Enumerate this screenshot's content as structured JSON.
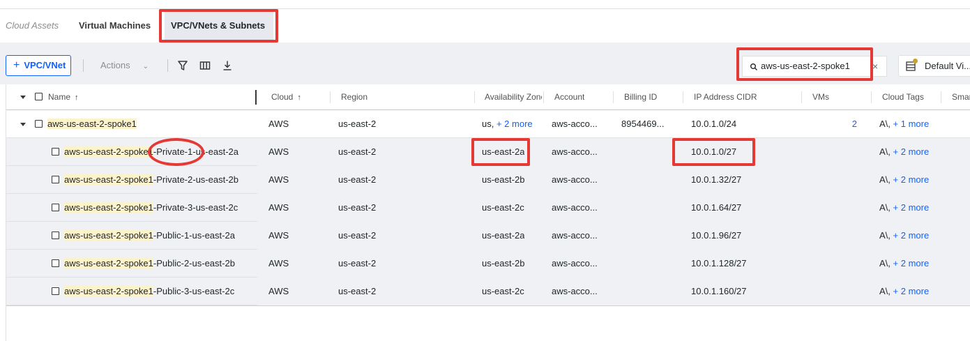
{
  "tabs": [
    {
      "label": "Cloud Assets"
    },
    {
      "label": "Virtual Machines"
    },
    {
      "label": "VPC/VNets & Subnets"
    }
  ],
  "toolbar": {
    "add_button_label": "VPC/VNet",
    "actions_label": "Actions",
    "search_value": "aws-us-east-2-spoke1",
    "view_label": "Default Vi...",
    "icons": [
      "plus-icon",
      "chevron-down-icon",
      "filter-icon",
      "columns-icon",
      "download-icon",
      "search-icon",
      "close-icon",
      "view-list-icon"
    ]
  },
  "columns": [
    {
      "label": "Name"
    },
    {
      "label": "Cloud"
    },
    {
      "label": "Region"
    },
    {
      "label": "Availability Zone"
    },
    {
      "label": "Account"
    },
    {
      "label": "Billing ID"
    },
    {
      "label": "IP Address CIDR"
    },
    {
      "label": "VMs"
    },
    {
      "label": "Cloud Tags"
    },
    {
      "label": "Smar"
    }
  ],
  "parent_row": {
    "name": "aws-us-east-2-spoke1",
    "cloud": "AWS",
    "region": "us-east-2",
    "az_prefix": "us",
    "az_more": "+ 2 more",
    "account": "aws-acco...",
    "billing_id": "8954469...",
    "cidr": "10.0.1.0/24",
    "vms": "2",
    "tags_prefix": "A\\",
    "tags_more": "+ 1 more"
  },
  "child_rows": [
    {
      "name_hl": "aws-us-east-2-spoke1",
      "name_rest": "-Private-1-us-east-2a",
      "cloud": "AWS",
      "region": "us-east-2",
      "az": "us-east-2a",
      "account": "aws-acco...",
      "cidr": "10.0.1.0/27",
      "tags_prefix": "A\\",
      "tags_more": "+ 2 more"
    },
    {
      "name_hl": "aws-us-east-2-spoke1",
      "name_rest": "-Private-2-us-east-2b",
      "cloud": "AWS",
      "region": "us-east-2",
      "az": "us-east-2b",
      "account": "aws-acco...",
      "cidr": "10.0.1.32/27",
      "tags_prefix": "A\\",
      "tags_more": "+ 2 more"
    },
    {
      "name_hl": "aws-us-east-2-spoke1",
      "name_rest": "-Private-3-us-east-2c",
      "cloud": "AWS",
      "region": "us-east-2",
      "az": "us-east-2c",
      "account": "aws-acco...",
      "cidr": "10.0.1.64/27",
      "tags_prefix": "A\\",
      "tags_more": "+ 2 more"
    },
    {
      "name_hl": "aws-us-east-2-spoke1",
      "name_rest": "-Public-1-us-east-2a",
      "cloud": "AWS",
      "region": "us-east-2",
      "az": "us-east-2a",
      "account": "aws-acco...",
      "cidr": "10.0.1.96/27",
      "tags_prefix": "A\\",
      "tags_more": "+ 2 more"
    },
    {
      "name_hl": "aws-us-east-2-spoke1",
      "name_rest": "-Public-2-us-east-2b",
      "cloud": "AWS",
      "region": "us-east-2",
      "az": "us-east-2b",
      "account": "aws-acco...",
      "cidr": "10.0.1.128/27",
      "tags_prefix": "A\\",
      "tags_more": "+ 2 more"
    },
    {
      "name_hl": "aws-us-east-2-spoke1",
      "name_rest": "-Public-3-us-east-2c",
      "cloud": "AWS",
      "region": "us-east-2",
      "az": "us-east-2c",
      "account": "aws-acco...",
      "cidr": "10.0.1.160/27",
      "tags_prefix": "A\\",
      "tags_more": "+ 2 more"
    }
  ],
  "colors": {
    "accent": "#0f62fe",
    "highlight": "#fdf3cb",
    "annotation_red": "#e53935",
    "row_band": "#f0f1f5",
    "toolbar_band": "#eef0f4"
  }
}
